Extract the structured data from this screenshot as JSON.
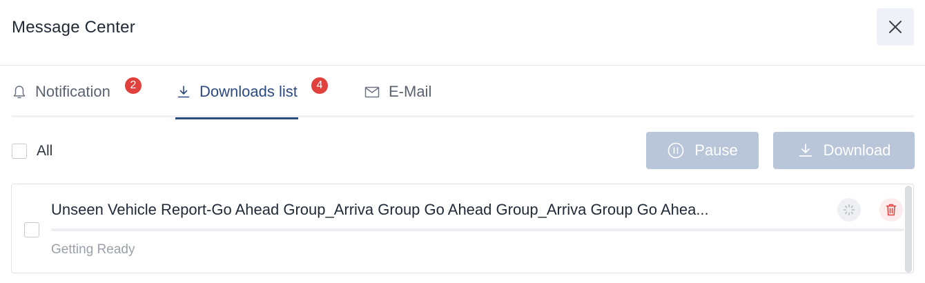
{
  "header": {
    "title": "Message Center",
    "close_icon": "close-icon"
  },
  "tabs": [
    {
      "label": "Notification",
      "icon": "bell-icon",
      "badge": "2",
      "active": false
    },
    {
      "label": "Downloads list",
      "icon": "download-icon",
      "badge": "4",
      "active": true
    },
    {
      "label": "E-Mail",
      "icon": "mail-icon",
      "active": false
    }
  ],
  "toolbar": {
    "select_all_label": "All",
    "pause_label": "Pause",
    "pause_icon": "pause-circle-icon",
    "download_label": "Download",
    "download_icon": "download-icon"
  },
  "downloads": [
    {
      "title": "Unseen Vehicle Report-Go Ahead Group_Arriva Group Go Ahead Group_Arriva Group Go Ahea...",
      "status": "Getting Ready",
      "progress": 0,
      "actions": [
        "loading-spinner-icon",
        "trash-icon"
      ]
    }
  ],
  "colors": {
    "accent": "#2b4a82",
    "badge": "#e0413d",
    "button_disabled": "#b9c5d9",
    "delete": "#e0413d"
  }
}
